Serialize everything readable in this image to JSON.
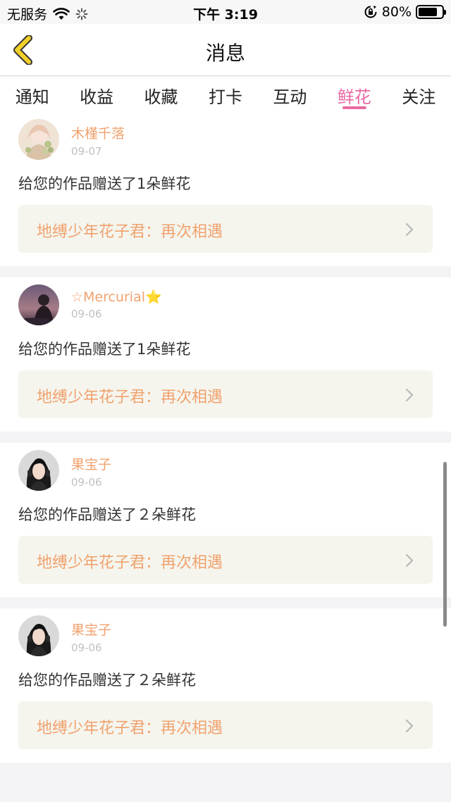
{
  "status": {
    "carrier": "无服务",
    "time": "下午 3:19",
    "battery": "80%",
    "battery_level": 0.8
  },
  "nav": {
    "title": "消息"
  },
  "tabs": [
    "通知",
    "收益",
    "收藏",
    "打卡",
    "互动",
    "鲜花",
    "关注"
  ],
  "active_tab": "鲜花",
  "items": [
    {
      "name": "木槿千落",
      "date": "09-07",
      "message": "给您的作品赠送了1朵鲜花",
      "work": "地缚少年花子君：再次相遇"
    },
    {
      "name": "☆Mercurial⭐",
      "date": "09-06",
      "message": "给您的作品赠送了1朵鲜花",
      "work": "地缚少年花子君：再次相遇"
    },
    {
      "name": "果宝子",
      "date": "09-06",
      "message": "给您的作品赠送了２朵鲜花",
      "work": "地缚少年花子君：再次相遇"
    },
    {
      "name": "果宝子",
      "date": "09-06",
      "message": "给您的作品赠送了２朵鲜花",
      "work": "地缚少年花子君：再次相遇"
    }
  ],
  "colors": {
    "accent": "#e96aa3",
    "name": "#f0a26e",
    "back_arrow": "#f2d02a"
  }
}
